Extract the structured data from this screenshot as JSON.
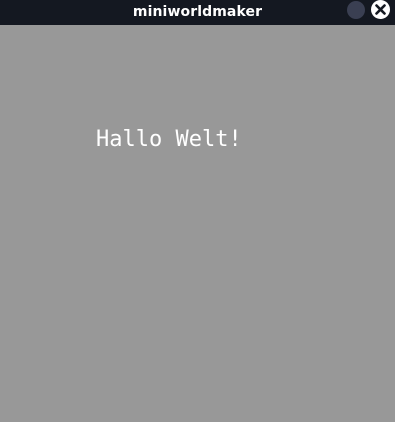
{
  "window": {
    "title": "miniworldmaker",
    "controls": {
      "minimize_icon": "circle-icon",
      "close_icon": "close-icon"
    }
  },
  "canvas": {
    "background_color": "#989898",
    "text": "Hallo Welt!",
    "text_color": "#ffffff"
  },
  "colors": {
    "titlebar": "#141821",
    "minimize_button": "#3a3f52",
    "close_button": "#ffffff"
  }
}
